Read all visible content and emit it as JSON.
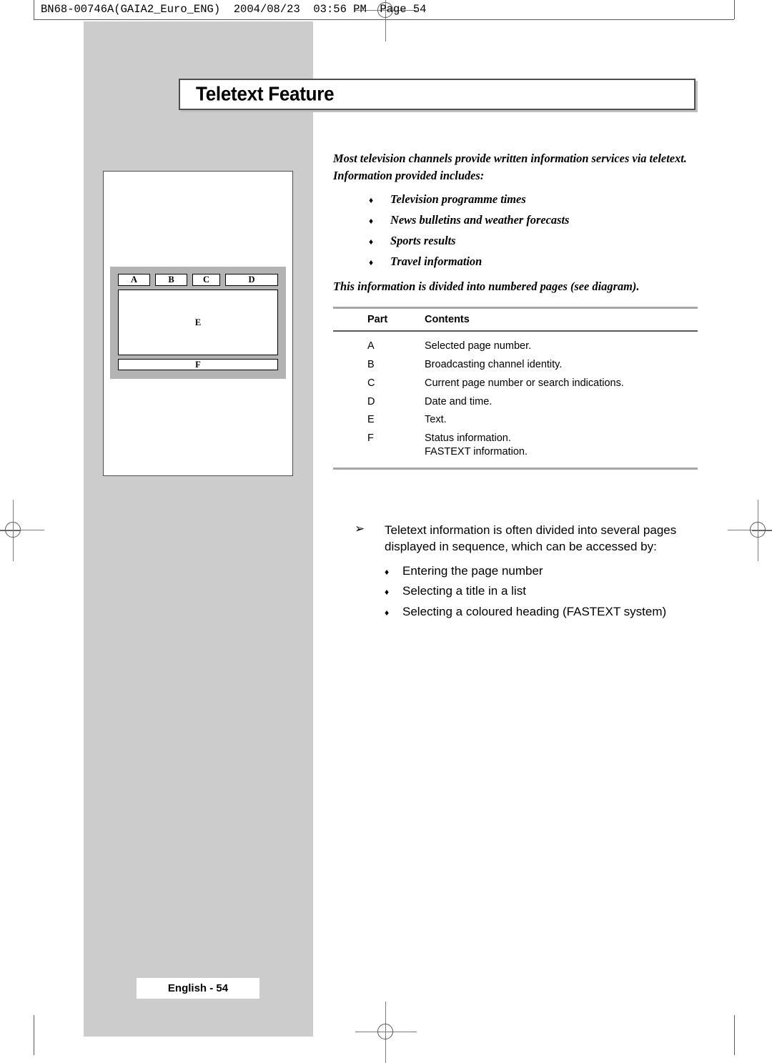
{
  "print_header": {
    "text": "BN68-00746A(GAIA2_Euro_ENG)  2004/08/23  03:56 PM  Page 54"
  },
  "title": {
    "text": "Teletext Feature"
  },
  "diagram": {
    "name": "teletext-screen-layout",
    "top_row": [
      {
        "key": "A",
        "label": "A"
      },
      {
        "key": "B",
        "label": "B"
      },
      {
        "key": "C",
        "label": "C"
      },
      {
        "key": "D",
        "label": "D"
      }
    ],
    "screen_label": "E",
    "status_label": "F"
  },
  "intro": {
    "paragraph": "Most television channels provide written information services via teletext. Information provided includes:",
    "bullet_glyph": "♦",
    "items": [
      "Television programme times",
      "News bulletins and weather forecasts",
      "Sports results",
      "Travel information"
    ],
    "divided_note": "This information is divided into numbered pages (see diagram)."
  },
  "parts_table": {
    "headers": {
      "part": "Part",
      "contents": "Contents"
    },
    "rows": [
      {
        "part": "A",
        "contents": [
          "Selected page number."
        ]
      },
      {
        "part": "B",
        "contents": [
          "Broadcasting channel identity."
        ]
      },
      {
        "part": "C",
        "contents": [
          "Current page number or search indications."
        ]
      },
      {
        "part": "D",
        "contents": [
          "Date and time."
        ]
      },
      {
        "part": "E",
        "contents": [
          "Text."
        ]
      },
      {
        "part": "F",
        "contents": [
          "Status information.",
          "FASTEXT information."
        ]
      }
    ]
  },
  "notes": {
    "arrow_glyph": "➢",
    "paragraph": "Teletext information is often divided into several pages displayed in sequence, which can be accessed by:",
    "bullet_glyph": "♦",
    "items": [
      "Entering the page number",
      "Selecting a title in a list",
      "Selecting a coloured heading (FASTEXT system)"
    ]
  },
  "footer": {
    "page_tag": "English - 54"
  },
  "colors": {
    "band_grey": "#cccccc",
    "rule_grey": "#a6a6a8",
    "rule_dark": "#58595b",
    "diagram_grey": "#b3b3b3"
  }
}
